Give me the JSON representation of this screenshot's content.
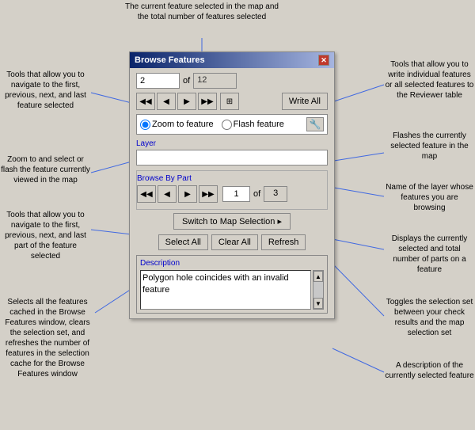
{
  "annotations": {
    "top_center": "The current feature selected in\nthe map and the total number of\nfeatures selected",
    "left_1": "Tools that allow you\nto navigate to the\nfirst, previous, next,\nand last feature\nselected",
    "left_2": "Zoom to and select\nor flash the feature\ncurrently viewed in\nthe map",
    "left_3": "Tools that allow you\nto navigate to the\nfirst, previous, next,\nand last part of the\nfeature selected",
    "left_4": "Selects all the\nfeatures cached in\nthe Browse Features\nwindow, clears the\nselection set, and\nrefreshes the\nnumber of features\nin the selection\ncache for the\nBrowse Features\nwindow",
    "right_1": "Tools that allow you\nto write individual\nfeatures or all\nselected features to\nthe Reviewer table",
    "right_2": "Flashes the currently\nselected feature in\nthe map",
    "right_3": "Name of the layer\nwhose features you\nare browsing",
    "right_4": "Displays the currently\nselected and total\nnumber of parts on a\nfeature",
    "right_5": "Toggles the\nselection set\nbetween your check\nresults and the map\nselection set",
    "right_6": "A description of the\ncurrently selected\nfeature"
  },
  "dialog": {
    "title": "Browse Features",
    "feature_current": "2",
    "of_label": "of",
    "feature_total": "12",
    "nav_first": "◀◀",
    "nav_prev": "◀",
    "nav_next": "▶",
    "nav_last": "▶▶",
    "write_all": "Write All",
    "zoom_label": "Zoom to feature",
    "flash_label": "Flash feature",
    "layer_label": "Layer",
    "layer_value": "",
    "browse_by_part_label": "Browse By Part",
    "part_current": "1",
    "of_label2": "of",
    "part_total": "3",
    "switch_btn": "Switch to Map Selection ▸",
    "select_all": "Select All",
    "clear_all": "Clear All",
    "refresh": "Refresh",
    "description_label": "Description",
    "description_text": "Polygon hole coincides with an invalid feature"
  }
}
